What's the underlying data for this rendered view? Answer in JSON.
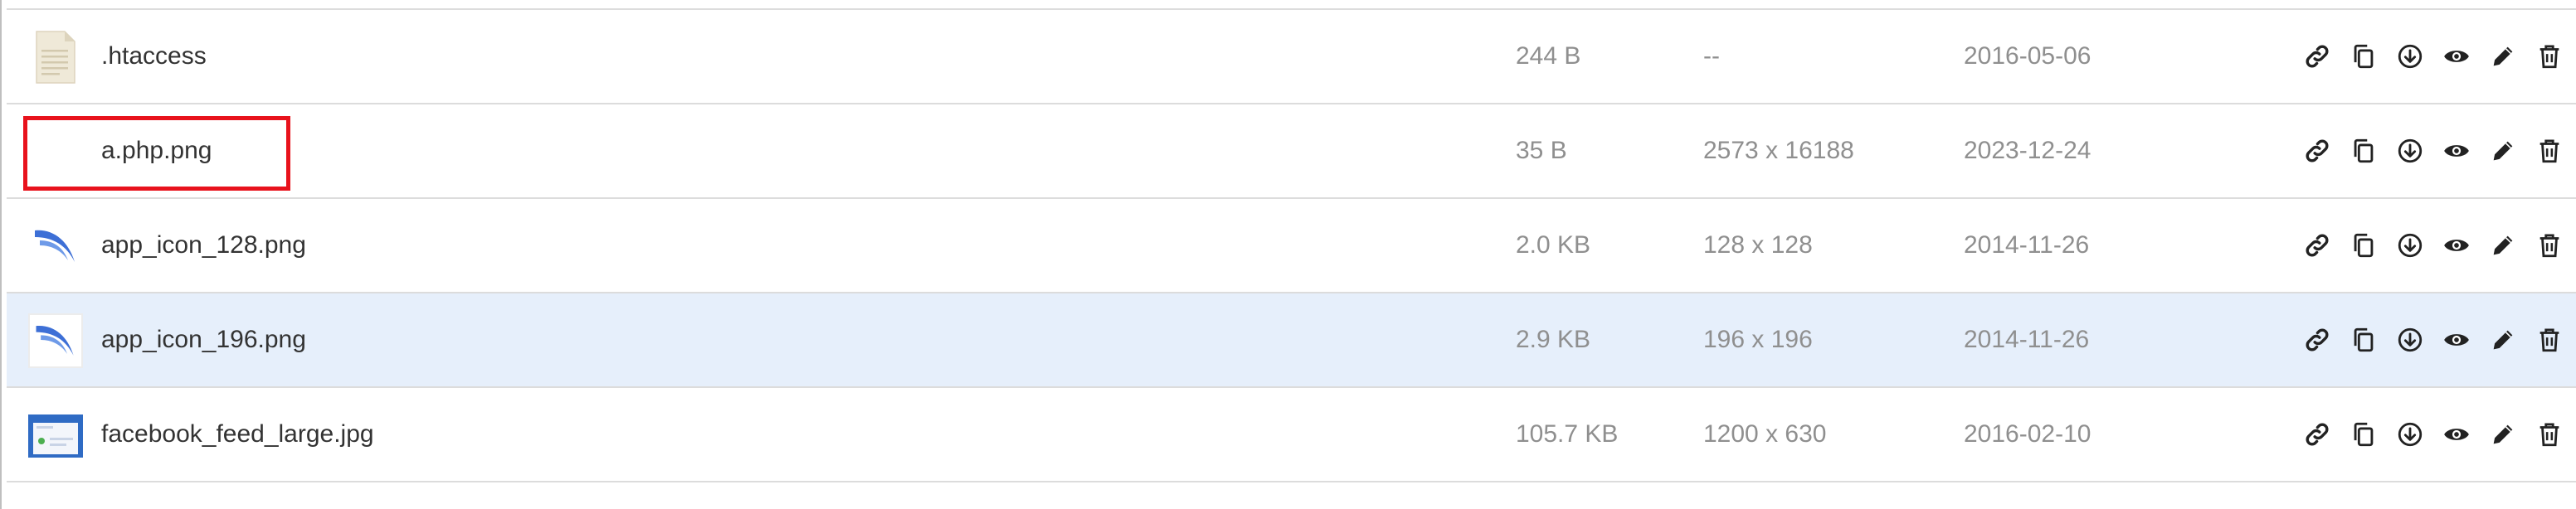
{
  "files": [
    {
      "name": ".htaccess",
      "size": "244 B",
      "dimensions": "--",
      "date": "2016-05-06",
      "thumb": "document-icon"
    },
    {
      "name": "a.php.png",
      "size": "35 B",
      "dimensions": "2573 x 16188",
      "date": "2023-12-24",
      "thumb": "blank-image-icon"
    },
    {
      "name": "app_icon_128.png",
      "size": "2.0 KB",
      "dimensions": "128 x 128",
      "date": "2014-11-26",
      "thumb": "app-swoosh-icon"
    },
    {
      "name": "app_icon_196.png",
      "size": "2.9 KB",
      "dimensions": "196 x 196",
      "date": "2014-11-26",
      "thumb": "app-swoosh-icon"
    },
    {
      "name": "facebook_feed_large.jpg",
      "size": "105.7 KB",
      "dimensions": "1200 x 630",
      "date": "2016-02-10",
      "thumb": "facebook-feed-thumbnail"
    }
  ],
  "actions": [
    "link-icon",
    "copy-icon",
    "download-icon",
    "preview-eye-icon",
    "edit-pencil-icon",
    "delete-trash-icon"
  ],
  "colors": {
    "highlight_border": "#e8121c",
    "selected_row_bg": "#e6effb",
    "secondary_text": "#8f8f8f",
    "primary_text": "#333333",
    "icon_color": "#222222",
    "swoosh_blue": "#3d6fd6"
  }
}
